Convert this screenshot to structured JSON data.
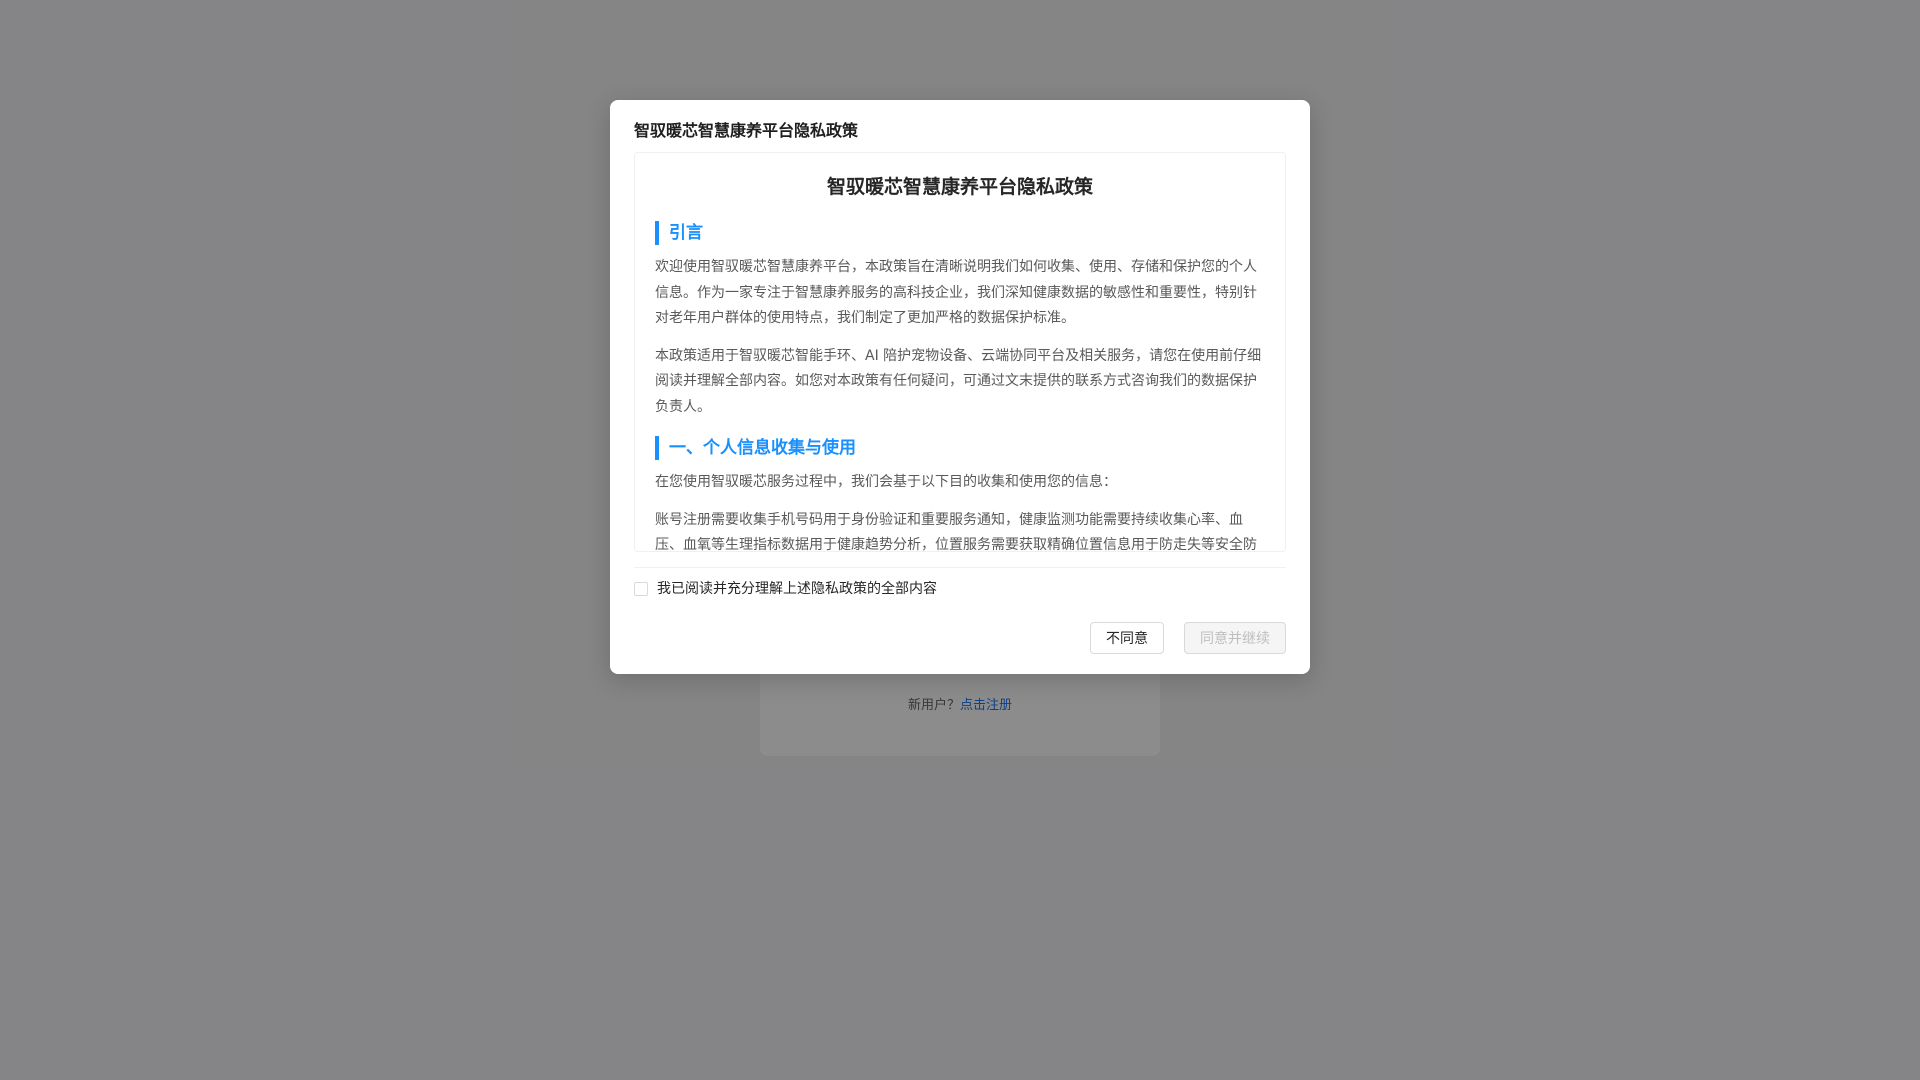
{
  "background": {
    "register_prompt": "新用户？",
    "register_link": "点击注册"
  },
  "modal": {
    "title": "智驭暖芯智慧康养平台隐私政策",
    "policy": {
      "heading": "智驭暖芯智慧康养平台隐私政策",
      "sections": [
        {
          "title": "引言",
          "paragraphs": [
            "欢迎使用智驭暖芯智慧康养平台，本政策旨在清晰说明我们如何收集、使用、存储和保护您的个人信息。作为一家专注于智慧康养服务的高科技企业，我们深知健康数据的敏感性和重要性，特别针对老年用户群体的使用特点，我们制定了更加严格的数据保护标准。",
            "本政策适用于智驭暖芯智能手环、AI 陪护宠物设备、云端协同平台及相关服务，请您在使用前仔细阅读并理解全部内容。如您对本政策有任何疑问，可通过文末提供的联系方式咨询我们的数据保护负责人。"
          ]
        },
        {
          "title": "一、个人信息收集与使用",
          "paragraphs": [
            "在您使用智驭暖芯服务过程中，我们会基于以下目的收集和使用您的信息：",
            "账号注册需要收集手机号码用于身份验证和重要服务通知，健康监测功能需要持续收集心率、血压、血氧等生理指标数据用于健康趋势分析，位置服务需要获取精确位置信息用于防走失等安全防"
          ]
        }
      ]
    },
    "agree_checkbox_label": "我已阅读并充分理解上述隐私政策的全部内容",
    "agree_checked": false,
    "disagree_button": "不同意",
    "agree_button": "同意并继续",
    "agree_button_disabled": true
  },
  "colors": {
    "accent": "#1890ff",
    "overlay": "rgba(0,0,0,0.45)"
  }
}
